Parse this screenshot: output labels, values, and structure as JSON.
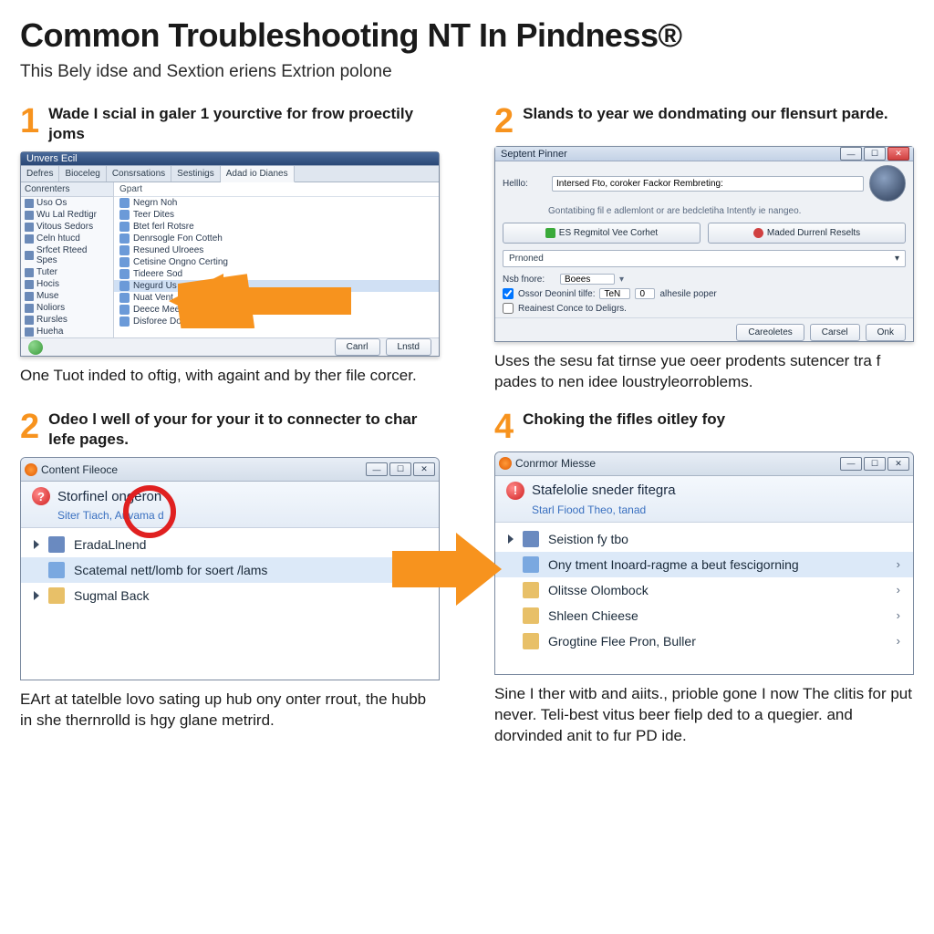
{
  "page": {
    "title": "Common Troubleshooting NT In Pindness®",
    "subtitle": "This Bely idse and Sextion eriens Extrion polone"
  },
  "step1": {
    "num": "1",
    "head": "Wade I scial in galer 1 yourctive for frow proectily joms",
    "win_title": "Unvers Ecil",
    "tabs": [
      "Defres",
      "Bioceleg",
      "Consrsations",
      "Sestinigs",
      "Adad io Dianes"
    ],
    "side_head": "Conrenters",
    "side": [
      "Uso Os",
      "Wu Lal Redtigr",
      "Vitous Sedors",
      "Celn htucd",
      "Srfcet Rteed Spes",
      "Tuter",
      "Hocis",
      "Muse",
      "Noliors",
      "Rursles",
      "Hueha"
    ],
    "main_head": "Gpart",
    "main": [
      "Negrn Noh",
      "Teer Dites",
      "Btet ferl Rotsre",
      "Denrsogle Fon Cotteh",
      "Resuned Ulroees",
      "Cetisine Ongno Certing",
      "Tideere Sod",
      "Negurd Us",
      "Nuat Vent",
      "Deece Meer",
      "Disforee Dom"
    ],
    "btn_cancel": "Canrl",
    "btn_ok": "Lnstd",
    "caption": "One Tuot inded to oftig, with againt and by ther file corcer."
  },
  "step2": {
    "num": "2",
    "head": "Slands to year we dondmating our flensurt parde.",
    "win_title": "Septent Pinner",
    "hello_lbl": "Helllo:",
    "hello_val": "Intersed Fto, coroker Fackor Rembreting:",
    "info": "Gontatibing fil e adlemlont or are bedcletiha Intently ie nangeo.",
    "btn_green": "ES Regmitol Vee Corhet",
    "btn_red": "Maded Durrenl Reselts",
    "drop": "Prnoned",
    "nb_lbl": "Nsb fnore:",
    "nb_val": "Boees",
    "chk1": "Ossor Deoninl tilfe:",
    "chk1_a": "TeN",
    "chk1_b": "0",
    "chk1_tail": "alhesile poper",
    "chk2": "Reainest Conce to Deligrs.",
    "btn1": "Careoletes",
    "btn2": "Carsel",
    "btn3": "Onk",
    "caption": "Uses the sesu fat tirnse yue oeer prodents sutencer tra f pades to nen idee loustryleorroblems."
  },
  "step3": {
    "num": "2",
    "head": "Odeo l well of your for your it to connecter to char lefe pages.",
    "win_title": "Content Fileoce",
    "header": "Storfinel ongeron",
    "sub": "Siter Tiach, Auvama d",
    "items": [
      "EradaLlnend",
      "Scatemal nett/lomb for soert /lams",
      "Sugmal Back"
    ],
    "caption": "EArt at tatelble lovo sating up hub ony onter rrout, the hubb in she thernrolld is hgy glane metrird."
  },
  "step4": {
    "num": "4",
    "head": "Choking the fifles oitley foy",
    "win_title": "Conrmor Miesse",
    "header": "Stafelolie sneder fitegra",
    "sub": "Starl Fiood Theo, tanad",
    "items": [
      "Seistion fy tbo",
      "Ony tment Inoard-ragme a beut fescigorning",
      "Olitsse Olombock",
      "Shleen Chieese",
      "Grogtine Flee Pron, Buller"
    ],
    "caption": "Sine I ther witb and aiits., prioble gone I now The clitis for put never. Teli-best vitus beer fielp ded to a quegier. and dorvinded anit to fur PD ide."
  }
}
